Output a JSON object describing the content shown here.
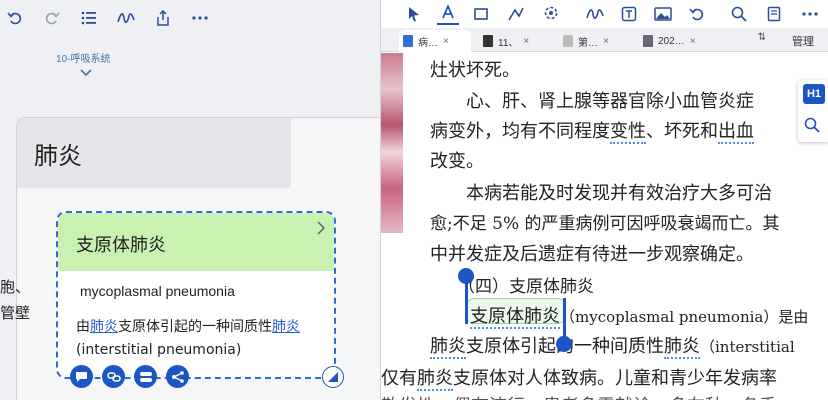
{
  "left": {
    "toolbar": {
      "icons": [
        "undo-icon",
        "redo-icon",
        "outline-list-icon",
        "handwriting-icon",
        "share-icon",
        "more-icon"
      ]
    },
    "breadcrumb": "10-呼吸系统",
    "mindmap": {
      "root_label": "肺炎",
      "card": {
        "title": "支原体肺炎",
        "english": "mycoplasmal pneumonia",
        "desc_parts": [
          "由",
          "肺炎",
          "支原体引起的一种间质性",
          "肺炎",
          "(interstitial  pneumonia)"
        ],
        "buttons": [
          "comment-icon",
          "link-icon",
          "group-icon",
          "share-node-icon"
        ]
      }
    }
  },
  "right": {
    "toolbar": {
      "icons": [
        "pointer-icon",
        "text-highlight-icon",
        "rectangle-select-icon",
        "shape-icon",
        "lasso-icon",
        "pen-icon",
        "textbox-icon",
        "image-icon",
        "undo-icon",
        "search-icon",
        "bookmark-icon",
        "more-icon"
      ]
    },
    "tabs": [
      {
        "label": "病…",
        "close": "×"
      },
      {
        "label": "11、",
        "close": "×"
      },
      {
        "label": "第…",
        "close": "×"
      },
      {
        "label": "202…",
        "close": "×"
      }
    ],
    "tab_manage": "管理",
    "tab_sort": "⇅",
    "float": {
      "h1": "H1"
    },
    "side_labels": [
      "胞、",
      "管壁",
      "仅有"
    ],
    "text": {
      "l1": "灶状坏死。",
      "l2a": "心、肝、肾上腺等器官除小血管炎症",
      "l3a": "病变外，均有不同程度",
      "l3b": "变性",
      "l3c": "、坏死和",
      "l3d": "出血",
      "l4": "改变。",
      "l5": "本病若能及时发现并有效治疗大多可治",
      "l6": "愈;不足 5% 的严重病例可因呼吸衰竭而亡。其",
      "l7": "中并发症及后遗症有待进一步观察确定。",
      "l8": "（四）支原体肺炎",
      "l9a": "支原体肺炎",
      "l9b": "（mycoplasmal  pneumonia）是由",
      "l10a": "肺炎",
      "l10b": "支原体引起的一种间质性",
      "l10c": "肺炎",
      "l10d": "（interstitial",
      "l11a": "仅有",
      "l11b": "肺炎",
      "l11c": "支原体对人体致病。儿童和青少年发病率",
      "l12": "散发性，偶有流行。患者多需就诊，多在秋、冬季"
    }
  },
  "colors": {
    "accent": "#1d55c4",
    "card_header": "#c8f1b2",
    "link": "#2a5bd7"
  }
}
